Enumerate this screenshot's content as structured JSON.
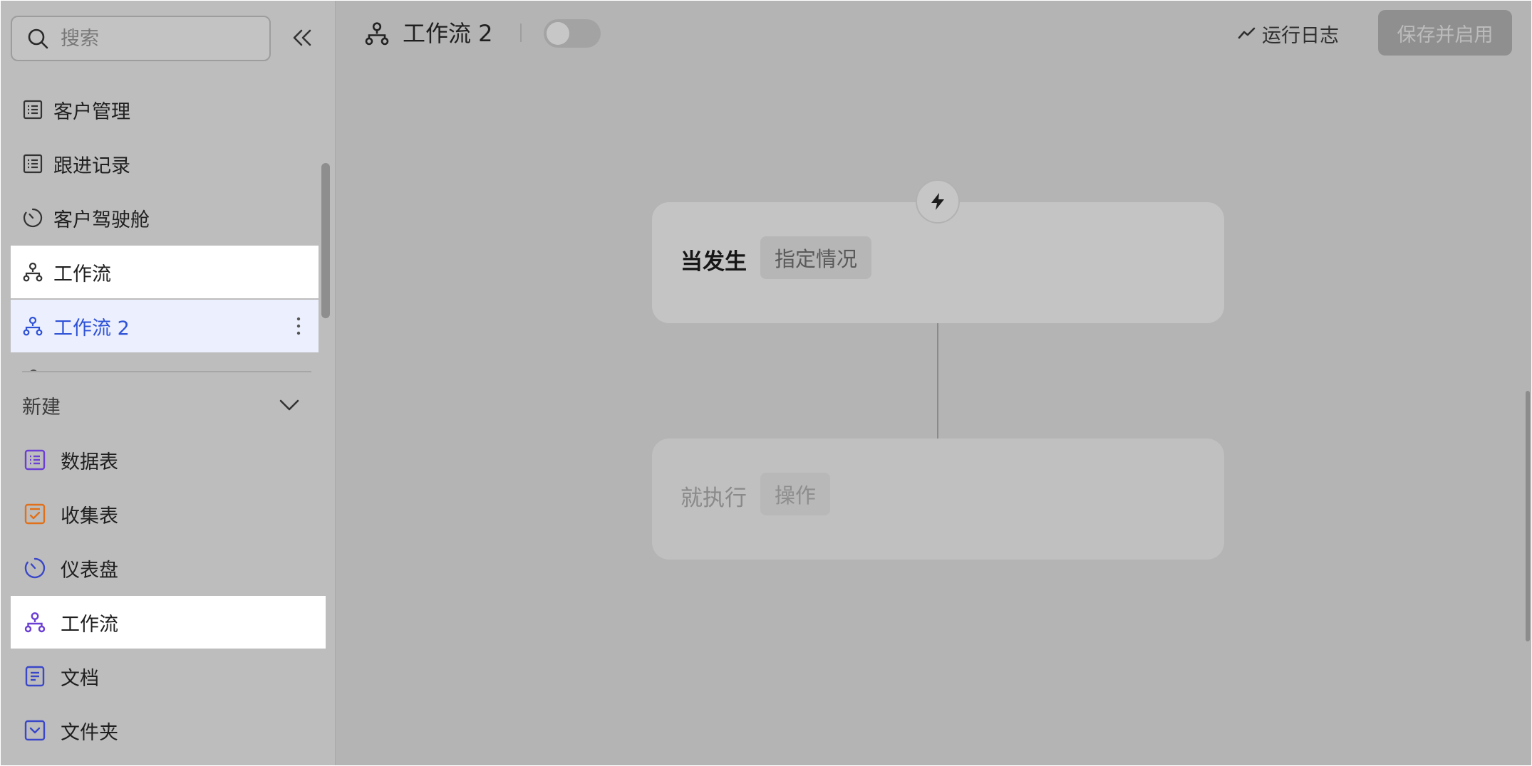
{
  "sidebar": {
    "search_placeholder": "搜索",
    "items": [
      {
        "label": "客户管理"
      },
      {
        "label": "跟进记录"
      },
      {
        "label": "客户驾驶舱"
      },
      {
        "label": "工作流"
      },
      {
        "label": "工作流 2"
      }
    ],
    "new_section": {
      "title": "新建",
      "items": [
        {
          "label": "数据表"
        },
        {
          "label": "收集表"
        },
        {
          "label": "仪表盘"
        },
        {
          "label": "工作流"
        },
        {
          "label": "文档"
        },
        {
          "label": "文件夹"
        }
      ]
    }
  },
  "header": {
    "title": "工作流 2",
    "run_log_label": "运行日志",
    "save_label": "保存并启用"
  },
  "canvas": {
    "trigger": {
      "label": "当发生",
      "chip": "指定情况"
    },
    "action": {
      "label": "就执行",
      "chip": "操作"
    }
  },
  "colors": {
    "active_blue": "#2e52d7",
    "purple": "#6b3fd4",
    "orange": "#e0701a",
    "indigo": "#3a47c8"
  }
}
